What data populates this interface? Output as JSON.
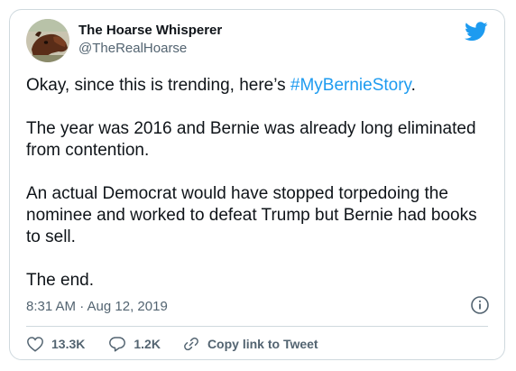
{
  "author": {
    "display_name": "The Hoarse Whisperer",
    "handle": "@TheRealHoarse",
    "avatar_icon": "horse-head-avatar"
  },
  "brand_icon": "twitter-bird-icon",
  "colors": {
    "accent": "#1d9bf0",
    "text": "#0f1419",
    "muted": "#536471",
    "border": "#cfd9de"
  },
  "tweet": {
    "line1_prefix": "Okay, since this is trending, here’s ",
    "hashtag": "#MyBernieStory",
    "line1_suffix": ".",
    "para2": "The year was 2016 and Bernie was already long eliminated from contention.",
    "para3": "An actual Democrat would have stopped torpedoing the nominee and worked to defeat Trump but Bernie had books to sell.",
    "para4": "The end."
  },
  "timestamp": "8:31 AM · Aug 12, 2019",
  "actions": {
    "likes": "13.3K",
    "replies": "1.2K",
    "copy_link": "Copy link to Tweet"
  }
}
